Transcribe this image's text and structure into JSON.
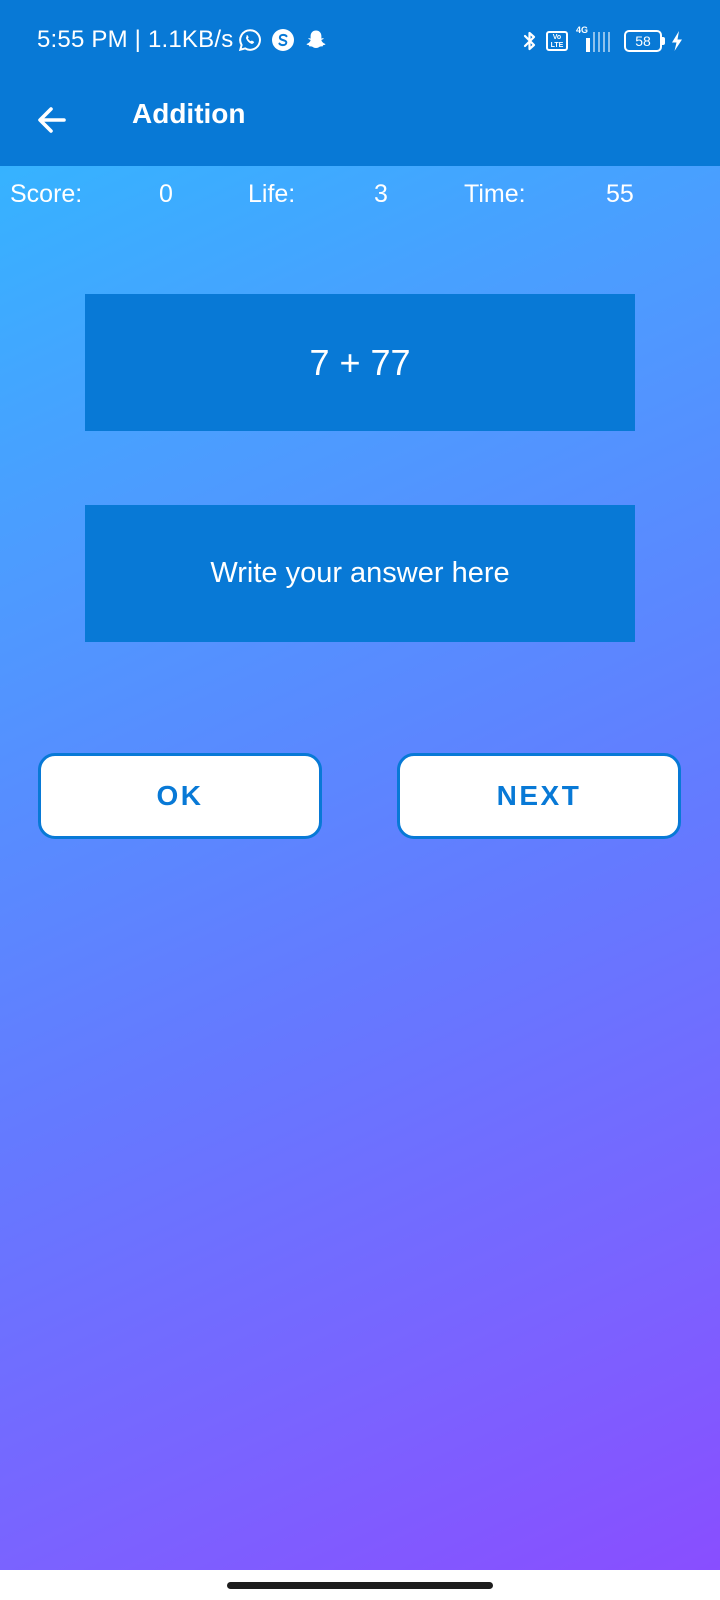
{
  "status_bar": {
    "time": "5:55 PM | 1.1KB/s",
    "left_icons": [
      "whatsapp-icon",
      "s-app-icon",
      "snapchat-icon"
    ],
    "right_icons": [
      "bluetooth-icon",
      "volte-icon",
      "signal-icon",
      "battery-icon",
      "charging-icon"
    ],
    "volte_top": "Vo",
    "volte_bottom": "LTE",
    "network": "4G",
    "battery": "58"
  },
  "app_bar": {
    "back_icon": "arrow-left-icon",
    "title": "Addition"
  },
  "stats": {
    "score_label": "Score:",
    "score_value": "0",
    "life_label": "Life:",
    "life_value": "3",
    "time_label": "Time:",
    "time_value": "55"
  },
  "question": {
    "expression": "7 + 77"
  },
  "answer": {
    "value": "",
    "placeholder": "Write your answer here"
  },
  "buttons": {
    "ok": "OK",
    "next": "NEXT"
  },
  "colors": {
    "primary": "#0879d6",
    "gradient_start": "#2dbcff",
    "gradient_end": "#8a4cff",
    "button_bg": "#ffffff",
    "text_light": "#ffffff"
  }
}
